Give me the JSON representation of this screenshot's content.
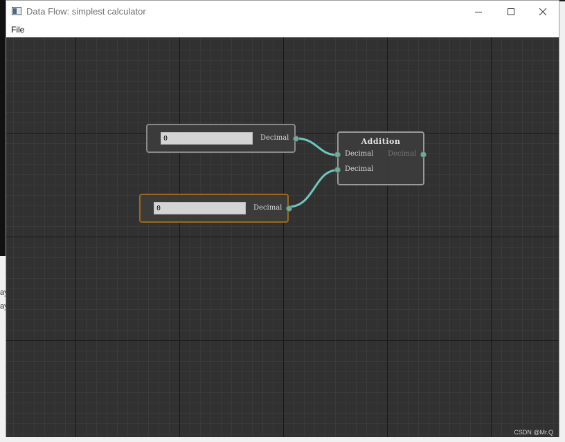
{
  "window": {
    "title": "Data Flow: simplest calculator"
  },
  "menu": {
    "file": "File"
  },
  "background_fragments": [
    "ay",
    "ay"
  ],
  "nodes": {
    "input_1": {
      "value": "0",
      "output_label": "Decimal"
    },
    "input_2": {
      "value": "0",
      "output_label": "Decimal"
    },
    "addition": {
      "title": "Addition",
      "inputs": [
        "Decimal",
        "Decimal"
      ],
      "output_label": "Decimal"
    }
  },
  "connections": [
    {
      "from": "input_1.output",
      "to": "addition.input_1"
    },
    {
      "from": "input_2.output",
      "to": "addition.input_2"
    }
  ],
  "colors": {
    "wire": "#6dc7bd",
    "selected_node_border": "#9a6a18",
    "canvas": "#313131"
  },
  "watermark": "CSDN @Mr.Q"
}
